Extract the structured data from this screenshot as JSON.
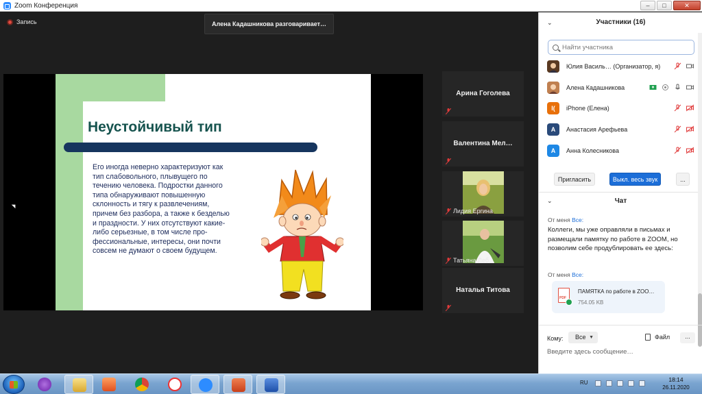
{
  "window": {
    "title": "Zoom Конференция",
    "minimize": "–",
    "maximize": "□",
    "close": "✕"
  },
  "main": {
    "recording_label": "Запись",
    "speaker_banner": "Алена Кадашникова разговаривает…",
    "slide": {
      "title": "Неустойчивый тип",
      "body": "Его иногда неверно характеризуют как тип слабовольного, плывущего по течению человека. Подростки данного типа обнаруживают повышенную склонность и тягу к развлечениям, причем без разбора, а также к безделью и праздности. У них отсутствуют какие-либо серьезные, в том числе про-фессиональные, интересы, они почти совсем не думают о своем будущем."
    },
    "thumbnails": [
      {
        "name": "Арина Гоголева",
        "type": "name"
      },
      {
        "name": "Валентина  Мел…",
        "type": "name"
      },
      {
        "name": "Лидия Ергина",
        "type": "photo"
      },
      {
        "name": "Татьяна Леб…",
        "type": "photo"
      },
      {
        "name": "Наталья Титова",
        "type": "name"
      }
    ]
  },
  "participants_panel": {
    "title": "Участники (16)",
    "search_placeholder": "Найти участника",
    "participants": [
      {
        "name": "Юлия Василь…  (Организатор, я)",
        "avatar_type": "photo",
        "avatar_color": "#7a4a2a",
        "avatar_letter": ""
      },
      {
        "name": "Алена Кадашникова",
        "avatar_type": "photo",
        "avatar_color": "#b07040",
        "avatar_letter": ""
      },
      {
        "name": "iPhone (Елена)",
        "avatar_type": "letter",
        "avatar_color": "#e8700a",
        "avatar_letter": "I("
      },
      {
        "name": "Анастасия Арефьева",
        "avatar_type": "letter",
        "avatar_color": "#2a4a7a",
        "avatar_letter": "A"
      },
      {
        "name": "Анна Колесникова",
        "avatar_type": "letter",
        "avatar_color": "#1e88e5",
        "avatar_letter": "A"
      }
    ],
    "invite_label": "Пригласить",
    "mute_all_label": "Выкл. весь звук",
    "more_label": "..."
  },
  "chat": {
    "title": "Чат",
    "messages": [
      {
        "from": "От меня",
        "to": "Все:",
        "text": "Коллеги, мы уже оправляли в письмах и размещали памятку по работе в ZOOM, но позволим себе продублировать ее здесь:"
      },
      {
        "from": "От меня",
        "to": "Все:",
        "file_name": "ПАМЯТКА по работе в ZOO…",
        "file_size": "754.05 KB",
        "file_badge": "PDF"
      }
    ],
    "to_label": "Кому:",
    "recipient": "Все",
    "file_button": "Файл",
    "more_button": "...",
    "input_placeholder": "Введите здесь сообщение…"
  },
  "taskbar": {
    "language": "RU",
    "time": "18:14",
    "date": "26.11.2020"
  },
  "colors": {
    "accent": "#1c6ed8",
    "slide_title": "#16534e",
    "slide_rule": "#16355e",
    "slide_green": "#a8d9a0",
    "mute_red": "#e03a3a"
  }
}
